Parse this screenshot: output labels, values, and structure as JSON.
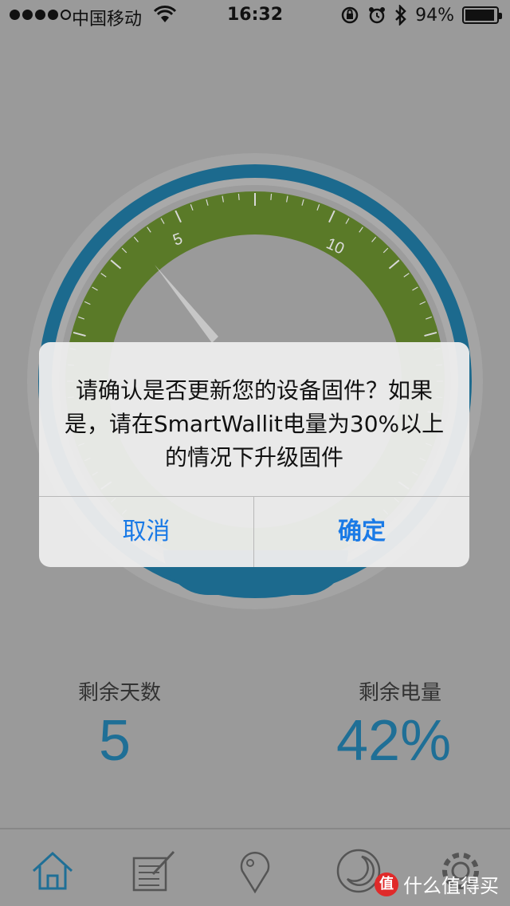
{
  "status_bar": {
    "carrier": "中国移动",
    "time": "16:32",
    "battery_percent": "94%",
    "battery_level": 0.94,
    "icons": [
      "signal-dots",
      "wifi-icon",
      "rotation-lock-icon",
      "alarm-icon",
      "bluetooth-icon",
      "battery-icon"
    ]
  },
  "gauge": {
    "tick_labels": [
      "5",
      "10"
    ],
    "button_label_partial": "消"
  },
  "stats": {
    "days_label": "剩余天数",
    "days_value": "5",
    "battery_label": "剩余电量",
    "battery_value": "42%"
  },
  "dialog": {
    "line1": "请确认是否更新您的设备固件？如果",
    "line2": "是，请在SmartWallit电量为30%以上",
    "line3": "的情况下升级固件",
    "cancel_label": "取消",
    "ok_label": "确定"
  },
  "tabs": [
    "home-icon",
    "notes-icon",
    "location-icon",
    "sleep-icon",
    "settings-icon"
  ],
  "watermark": {
    "badge": "值",
    "text": "什么值得买"
  },
  "colors": {
    "accent_blue": "#1f6f96",
    "gauge_green": "#5a7a28",
    "ios_button_blue": "#1a7ae6"
  }
}
